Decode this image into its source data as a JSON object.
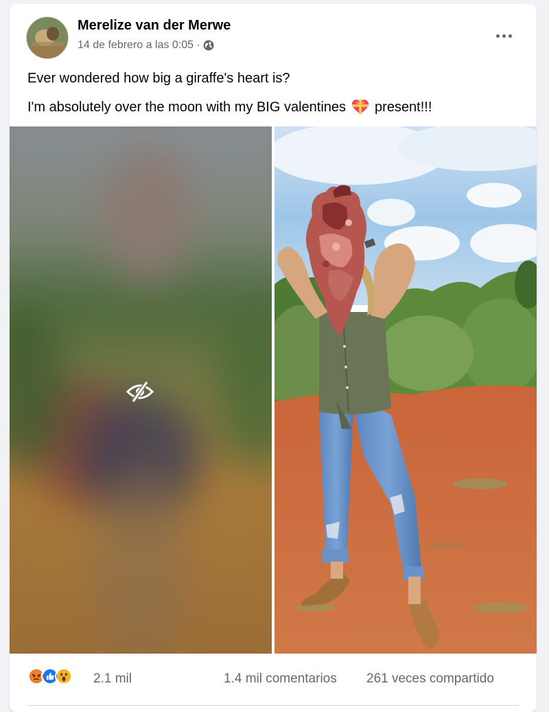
{
  "post": {
    "author": "Merelize van der Merwe",
    "timestamp": "14 de febrero a las 0:05 ·",
    "privacy_icon": "globe-icon",
    "more_icon": "more-options-icon",
    "text_line1": "Ever wondered how big a giraffe's heart is?",
    "text_line2_before": "I'm absolutely over the moon with my BIG valentines",
    "text_line2_emoji": "heart-with-ribbon-icon",
    "text_line2_after": "present!!!",
    "photos": [
      {
        "kind": "blurred-hidden",
        "overlay_icon": "eye-off-icon"
      },
      {
        "kind": "visible"
      }
    ]
  },
  "engagement": {
    "reactions": [
      "angry-reaction",
      "like-reaction",
      "wow-reaction"
    ],
    "reaction_count": "2.1 mil",
    "comments": "1.4 mil comentarios",
    "shares": "261 veces compartido"
  },
  "colors": {
    "background": "#f0f2f5",
    "card": "#ffffff",
    "secondary_text": "#65676b",
    "like_blue": "#1877f2",
    "angry_orange": "#e9710f",
    "wow_yellow": "#f7b125"
  }
}
